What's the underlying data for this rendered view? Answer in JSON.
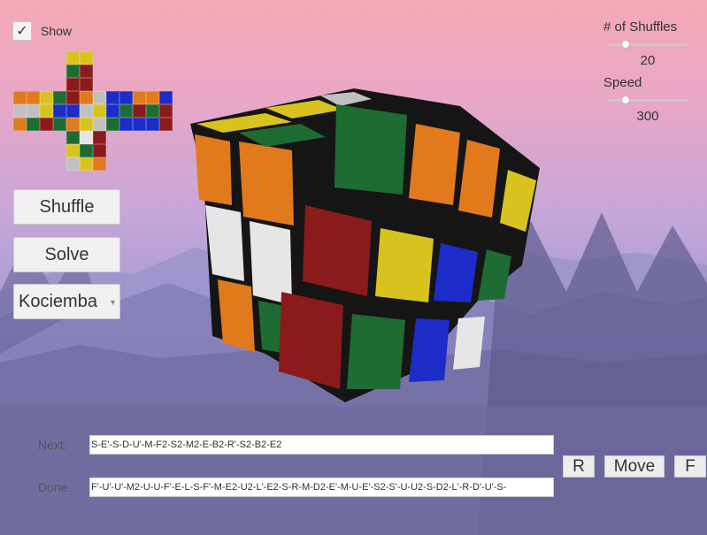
{
  "show_toggle": {
    "checked_glyph": "✓",
    "label": "Show"
  },
  "buttons": {
    "shuffle": "Shuffle",
    "solve": "Solve",
    "solver_select": "Kociemba"
  },
  "shuffles": {
    "label": "# of Shuffles",
    "value": "20",
    "level": 0.2
  },
  "speed": {
    "label": "Speed",
    "value": "300",
    "level": 0.2
  },
  "moves": {
    "next_label": "Next:",
    "next_value": "S-E'-S-D-U'-M-F2-S2-M2-E-B2-R'-S2-B2-E2",
    "done_label": "Done",
    "done_value": "F'-U'-U'-M2-U-U-F'-E-L-S-F'-M-E2-U2-L'-E2-S-R-M-D2-E'-M-U-E'-S2-S'-U-U2-S-D2-L'-R-D'-U'-S-"
  },
  "controls": {
    "r": "R",
    "move": "Move",
    "f": "F"
  },
  "colors": {
    "red": "#8b1a1a",
    "orange": "#e07a1d",
    "yellow": "#d8c21e",
    "green": "#1e6b33",
    "blue": "#1c2cc8",
    "white": "#e6e6e6",
    "gray": "#c0c0c0",
    "dark": "#2a2a2a"
  }
}
